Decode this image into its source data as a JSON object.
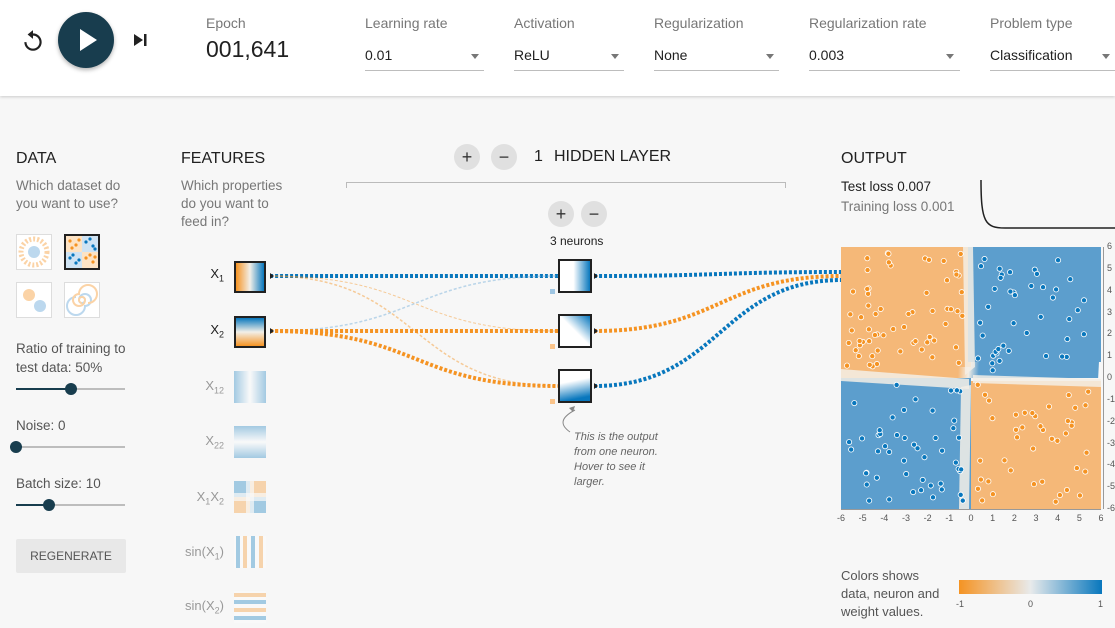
{
  "top": {
    "epoch_label": "Epoch",
    "epoch": "001,641",
    "controls": [
      {
        "label": "Learning rate",
        "value": "0.01"
      },
      {
        "label": "Activation",
        "value": "ReLU"
      },
      {
        "label": "Regularization",
        "value": "None"
      },
      {
        "label": "Regularization rate",
        "value": "0.003"
      },
      {
        "label": "Problem type",
        "value": "Classification"
      }
    ]
  },
  "data_panel": {
    "title": "DATA",
    "sub1": "Which dataset do",
    "sub2": "you want to use?",
    "ratio_l1": "Ratio of training to",
    "ratio_l2": "test data:  50%",
    "ratio": 0.5,
    "noise": "Noise:  0",
    "noise_val": 0,
    "batch": "Batch size:  10",
    "batch_val": 0.3,
    "regen": "REGENERATE"
  },
  "features": {
    "title": "FEATURES",
    "sub1": "Which properties",
    "sub2": "do you want to",
    "sub3": "feed in?",
    "items": [
      {
        "a": "X",
        "b": "1"
      },
      {
        "a": "X",
        "b": "2"
      },
      {
        "a": "X",
        "b": "12"
      },
      {
        "a": "X",
        "b": "22"
      },
      {
        "a": "X",
        "b": "1",
        "c": "X",
        "d": "2"
      },
      {
        "a": "sin(X",
        "b": "1",
        ")": ")"
      },
      {
        "a": "sin(X",
        "b": "2",
        ")": ")"
      }
    ]
  },
  "hidden": {
    "plus": "+",
    "minus": "−",
    "count": "1",
    "label": "HIDDEN LAYER",
    "neurons": "3 neurons",
    "note1": "This is the output",
    "note2": "from one neuron.",
    "note3": "Hover to see it",
    "note4": "larger."
  },
  "output": {
    "title": "OUTPUT",
    "test": "Test loss 0.007",
    "train": "Training loss 0.001",
    "yticks": [
      "6",
      "5",
      "4",
      "3",
      "2",
      "1",
      "0",
      "-1",
      "-2",
      "-3",
      "-4",
      "-5",
      "-6"
    ],
    "xticks": [
      "-6",
      "-5",
      "-4",
      "-3",
      "-2",
      "-1",
      "0",
      "1",
      "2",
      "3",
      "4",
      "5",
      "6"
    ],
    "legend1": "Colors shows",
    "legend2": "data, neuron and",
    "legend3": "weight values.",
    "scale": [
      "-1",
      "0",
      "1"
    ]
  },
  "colors": {
    "orange": "#f59322",
    "blue": "#0877bd",
    "dark": "#183d4e"
  }
}
